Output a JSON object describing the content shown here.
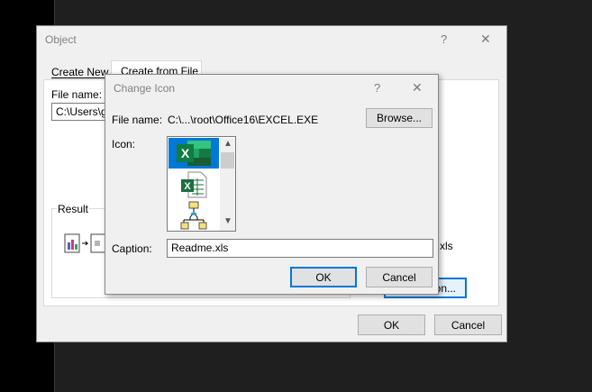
{
  "object_dialog": {
    "title": "Object",
    "help": "?",
    "close": "✕",
    "tabs": [
      {
        "label": "Create New"
      },
      {
        "label": "Create from File"
      }
    ],
    "file_name_label": "File name:",
    "file_name_value": "C:\\Users\\go",
    "result_label": "Result",
    "partial_text_1": "n",
    "partial_text_2": "xls",
    "change_icon_button_partial": "on...",
    "ok": "OK",
    "cancel": "Cancel"
  },
  "change_icon_dialog": {
    "title": "Change Icon",
    "help": "?",
    "close": "✕",
    "file_name_label": "File name:",
    "file_name_value": "C:\\...\\root\\Office16\\EXCEL.EXE",
    "browse": "Browse...",
    "icon_label": "Icon:",
    "caption_label": "Caption:",
    "caption_value": "Readme.xls",
    "ok": "OK",
    "cancel": "Cancel",
    "icons": [
      "excel-app-icon",
      "excel-sheet-icon",
      "org-chart-icon"
    ]
  },
  "colors": {
    "accent": "#0078d7",
    "excel_green": "#1d6f42"
  }
}
